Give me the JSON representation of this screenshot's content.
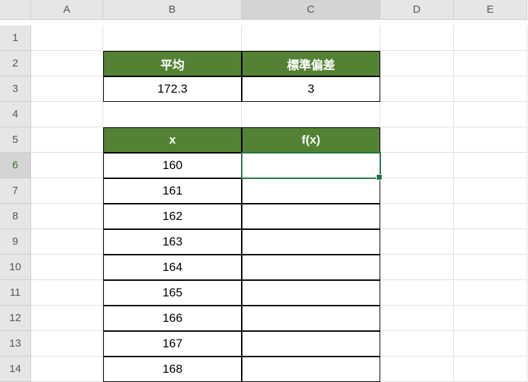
{
  "columns": [
    "A",
    "B",
    "C",
    "D",
    "E"
  ],
  "rows": [
    "1",
    "2",
    "3",
    "4",
    "5",
    "6",
    "7",
    "8",
    "9",
    "10",
    "11",
    "12",
    "13",
    "14"
  ],
  "selectedCell": "C6",
  "selectedRow": "6",
  "selectedCol": "C",
  "headers1": {
    "b2": "平均",
    "c2": "標準偏差"
  },
  "values1": {
    "b3": "172.3",
    "c3": "3"
  },
  "headers2": {
    "b5": "x",
    "c5": "f(x)"
  },
  "xvalues": {
    "b6": "160",
    "b7": "161",
    "b8": "162",
    "b9": "163",
    "b10": "164",
    "b11": "165",
    "b12": "166",
    "b13": "167",
    "b14": "168"
  }
}
